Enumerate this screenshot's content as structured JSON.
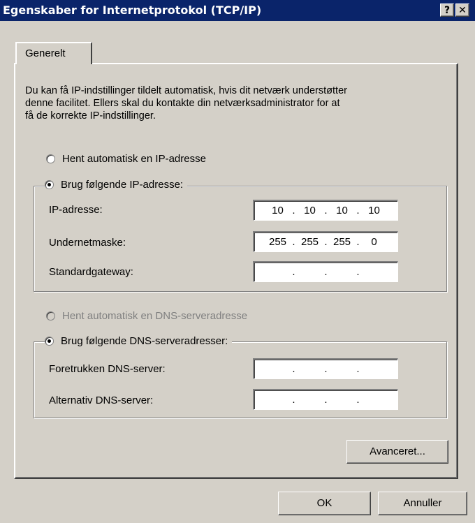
{
  "window": {
    "title": "Egenskaber for Internetprotokol (TCP/IP)",
    "help_label": "?",
    "close_label": "✕"
  },
  "tab": {
    "label": "Generelt"
  },
  "description": {
    "line1": "Du kan få IP-indstillinger tildelt automatisk, hvis dit netværk understøtter",
    "line2": "denne facilitet. Ellers skal du kontakte din netværksadministrator for at",
    "line3": "få de korrekte IP-indstillinger."
  },
  "ip": {
    "auto_label": "Hent automatisk en IP-adresse",
    "manual_label": "Brug følgende IP-adresse:",
    "address_label": "IP-adresse:",
    "address": [
      "10",
      "10",
      "10",
      "10"
    ],
    "subnet_label": "Undernetmaske:",
    "subnet": [
      "255",
      "255",
      "255",
      "0"
    ],
    "gateway_label": "Standardgateway:",
    "gateway": [
      "",
      "",
      "",
      ""
    ]
  },
  "dns": {
    "auto_label": "Hent automatisk en DNS-serveradresse",
    "manual_label": "Brug følgende DNS-serveradresser:",
    "preferred_label": "Foretrukken DNS-server:",
    "preferred": [
      "",
      "",
      "",
      ""
    ],
    "alternate_label": "Alternativ DNS-server:",
    "alternate": [
      "",
      "",
      "",
      ""
    ]
  },
  "buttons": {
    "advanced": "Avanceret...",
    "ok": "OK",
    "cancel": "Annuller"
  }
}
